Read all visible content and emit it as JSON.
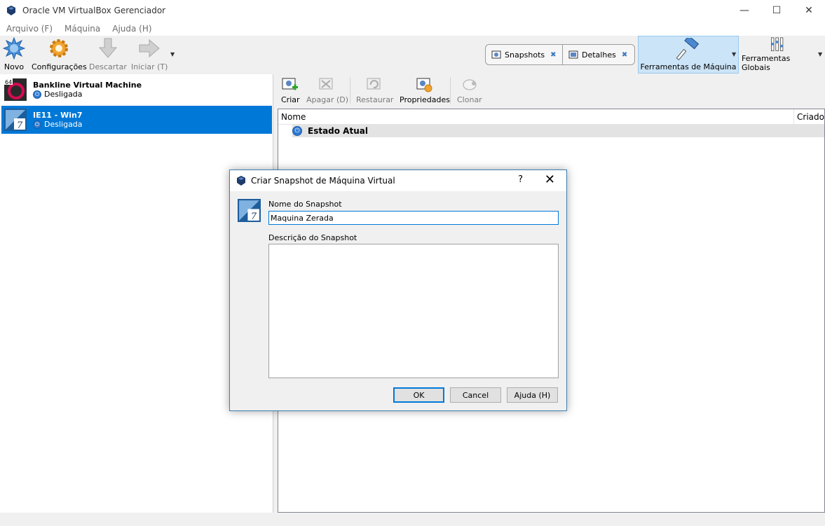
{
  "window": {
    "title": "Oracle VM VirtualBox Gerenciador",
    "minimize_glyph": "—",
    "maximize_glyph": "☐",
    "close_glyph": "✕"
  },
  "menu": {
    "items": [
      {
        "label": "Arquivo (F)"
      },
      {
        "label": "Máquina"
      },
      {
        "label": "Ajuda (H)"
      }
    ]
  },
  "toolbar": {
    "novo": "Novo",
    "configuracoes": "Configurações",
    "descartar": "Descartar",
    "iniciar": "Iniciar (T)",
    "snapshots": "Snapshots",
    "detalhes": "Detalhes",
    "ferramentas_maquina": "Ferramentas de Máquina",
    "ferramentas_globais": "Ferramentas Globais"
  },
  "vms": [
    {
      "name": "Bankline Virtual Machine",
      "state": "Desligada",
      "icon": "debian-64-icon",
      "badge": "64"
    },
    {
      "name": "IE11 - Win7",
      "state": "Desligada",
      "icon": "windows7-icon",
      "badge": "7"
    }
  ],
  "snapshot_toolbar": {
    "criar": "Criar",
    "apagar": "Apagar (D)",
    "restaurar": "Restaurar",
    "propriedades": "Propriedades",
    "clonar": "Clonar"
  },
  "snapshot_tree": {
    "col_name": "Nome",
    "col_created": "Criado",
    "current_state": "Estado Atual"
  },
  "dialog": {
    "title": "Criar Snapshot de Máquina Virtual",
    "help": "?",
    "close": "✕",
    "name_label": "Nome do Snapshot",
    "name_value": "Maquina Zerada",
    "desc_label": "Descrição do Snapshot",
    "desc_value": "",
    "ok": "OK",
    "cancel": "Cancel",
    "help_button": "Ajuda (H)"
  },
  "colors": {
    "selection": "#0078d7",
    "active_tool": "#cce4f7",
    "accent": "#3c7fb1"
  }
}
